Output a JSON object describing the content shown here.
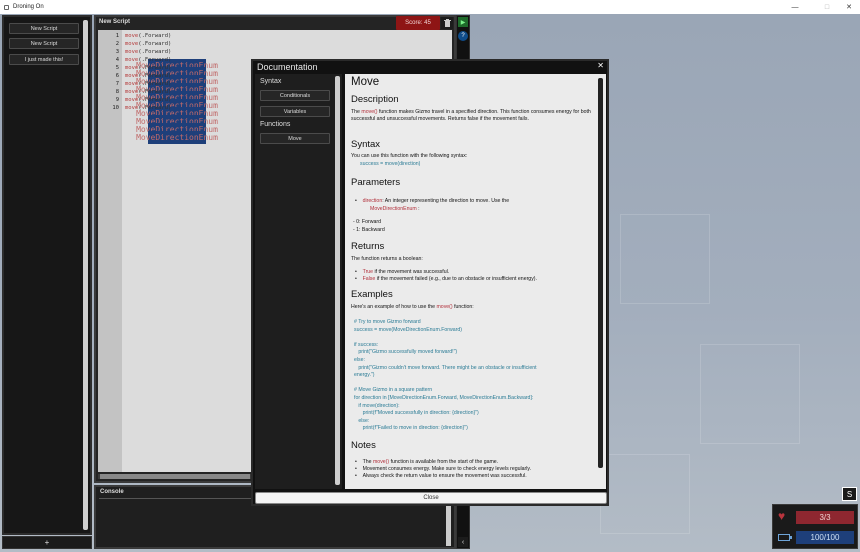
{
  "window": {
    "title": "Droning On",
    "minimize": "—",
    "maximize": "□",
    "close": "✕"
  },
  "sidebar": {
    "items": [
      {
        "label": "New Script"
      },
      {
        "label": "New Script"
      },
      {
        "label": "I just made this!"
      }
    ],
    "add_label": "+"
  },
  "editor": {
    "title": "New Script",
    "score": "Score: 45",
    "lines": [
      {
        "num": "1",
        "fn": "move",
        "enum": "MoveDirectionEnum",
        "val": ".Forward)"
      },
      {
        "num": "2",
        "fn": "move",
        "enum": "MoveDirectionEnum",
        "val": ".Forward)"
      },
      {
        "num": "3",
        "fn": "move",
        "enum": "MoveDirectionEnum",
        "val": ".Forward)"
      },
      {
        "num": "4",
        "fn": "move",
        "enum": "MoveDirectionEnum",
        "val": ".Forward)"
      },
      {
        "num": "5",
        "fn": "move",
        "enum": "MoveDirectionEnum",
        "val": ".Forward)"
      },
      {
        "num": "6",
        "fn": "move",
        "enum": "MoveDirectionEnum",
        "val": ".Forward)"
      },
      {
        "num": "7",
        "fn": "move",
        "enum": "MoveDirectionEnum",
        "val": ".Forward)"
      },
      {
        "num": "8",
        "fn": "move",
        "enum": "MoveDirectionEnum",
        "val": ".Forward)"
      },
      {
        "num": "9",
        "fn": "move",
        "enum": "MoveDirectionEnum",
        "val": ".Forward)"
      },
      {
        "num": "10",
        "fn": "move",
        "enum": "MoveDirectionEnum",
        "val": ".Forward)"
      }
    ]
  },
  "console": {
    "title": "Console"
  },
  "doc": {
    "title": "Documentation",
    "close_x": "✕",
    "close_label": "Close",
    "nav": {
      "syntax_label": "Syntax",
      "conditionals": "Conditionals",
      "variables": "Variables",
      "functions_label": "Functions",
      "move": "Move"
    },
    "page_title": "Move",
    "h_description": "Description",
    "desc_a": "The ",
    "desc_fn": "move()",
    "desc_b": " function makes Gizmo travel in a specified direction. This function consumes energy for both successful and unsuccessful movements. Returns false if the movement fails.",
    "h_syntax": "Syntax",
    "syntax_text": "You can use this function with the following syntax:",
    "syntax_code": "success = move(direction)",
    "h_parameters": "Parameters",
    "param_name": "direction",
    "param_desc": ": An integer representing the direction to move. Use the",
    "param_enum": "MoveDirectionEnum",
    "param_colon": ":",
    "param_v0": "- 0: Forward",
    "param_v1": "- 1: Backward",
    "h_returns": "Returns",
    "returns_text": "The function returns a boolean:",
    "ret_true": "True",
    "ret_true_desc": " if the movement was successful.",
    "ret_false": "False",
    "ret_false_desc": " if the movement failed (e.g., due to an obstacle or insufficient energy).",
    "h_examples": "Examples",
    "ex_intro_a": "Here's an example of how to use the ",
    "ex_intro_fn": "move()",
    "ex_intro_b": " function:",
    "ex_lines": [
      "# Try to move Gizmo forward",
      "success = move(MoveDirectionEnum.Forward)",
      "",
      "if success:",
      "   print(\"Gizmo successfully moved forward!\")",
      "else:",
      "   print(\"Gizmo couldn't move forward. There might be an obstacle or insufficient",
      "energy.\")",
      "",
      "# Move Gizmo in a square pattern",
      "for direction in [MoveDirectionEnum.Forward, MoveDirectionEnum.Backward]:",
      "   if move(direction):",
      "      print(f\"Moved successfully in direction: {direction}\")",
      "   else:",
      "      print(f\"Failed to move in direction: {direction}\")"
    ],
    "h_notes": "Notes",
    "note1_a": "The ",
    "note1_fn": "move()",
    "note1_b": " function is available from the start of the game.",
    "note2": "Movement consumes energy. Make sure to check energy levels regularly.",
    "note3": "Always check the return value to ensure the movement was successful."
  },
  "hud": {
    "s_key": "S",
    "health": "3/3",
    "energy": "100/100"
  },
  "colors": {
    "score_bg": "#8e1515",
    "health_bg": "#8e2730",
    "energy_bg": "#1e3f7a",
    "play": "#1e6b2b",
    "info": "#0f4c8a"
  }
}
